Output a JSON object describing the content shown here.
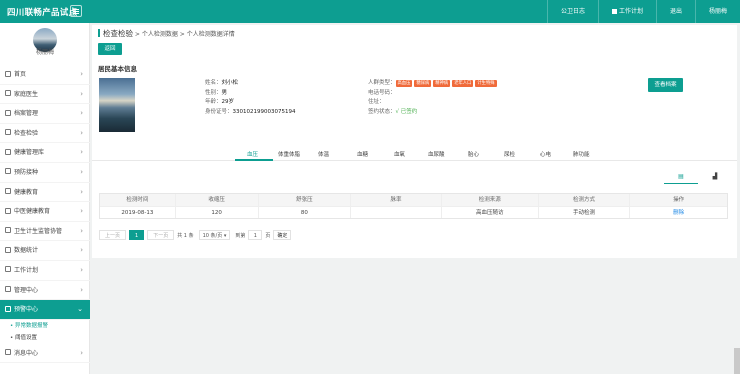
{
  "app": {
    "title": "四川联畅产品试点"
  },
  "topbar": {
    "links": [
      {
        "label": "公卫日志"
      },
      {
        "label": "工作计划"
      },
      {
        "label": "退出"
      },
      {
        "label": "杨丽梅"
      }
    ]
  },
  "user": {
    "name": "杨丽梅"
  },
  "sidebar": {
    "items": [
      {
        "label": "首页"
      },
      {
        "label": "家庭医生"
      },
      {
        "label": "档案管理"
      },
      {
        "label": "检查检验"
      },
      {
        "label": "健康管理库"
      },
      {
        "label": "预防接种"
      },
      {
        "label": "健康教育"
      },
      {
        "label": "中医健康教育"
      },
      {
        "label": "卫生计生监管协管"
      },
      {
        "label": "数据统计"
      },
      {
        "label": "工作计划"
      },
      {
        "label": "管理中心"
      },
      {
        "label": "预警中心"
      },
      {
        "label": "消息中心"
      }
    ],
    "submenu": [
      {
        "label": "异常数据报警"
      },
      {
        "label": "阈值设置"
      }
    ]
  },
  "breadcrumb": {
    "root": "检查检验",
    "level2": "个人检测数据",
    "level3": "个人检测数据详情"
  },
  "back_label": "返回",
  "section_title": "居民基本信息",
  "resident": {
    "name_label": "姓名：",
    "name": "刘小松",
    "gender_label": "性别：",
    "gender": "男",
    "age_label": "年龄：",
    "age": "29岁",
    "id_label": "身份证号：",
    "id": "330102199003075194",
    "type_label": "人群类型：",
    "tags": [
      "高血压",
      "糖尿病",
      "精神病",
      "老年人口",
      "计生特殊"
    ],
    "phone_label": "电话号码：",
    "phone": "",
    "address_label": "住址：",
    "address": "",
    "sign_label": "签约状态：",
    "sign_status": "√ 已签约"
  },
  "archive_button": "查看档案",
  "tabs": [
    "血压",
    "体重体脂",
    "体温",
    "血糖",
    "血氧",
    "血尿酸",
    "胎心",
    "尿检",
    "心电",
    "肺功能"
  ],
  "view_toggle": {
    "list": "▤",
    "chart": "▟"
  },
  "table": {
    "headers": [
      "检测时间",
      "收缩压",
      "舒张压",
      "脉率",
      "检测来源",
      "检测方式",
      "操作"
    ],
    "rows": [
      [
        "2019-08-13",
        "120",
        "80",
        "",
        "高血压随访",
        "手动检测",
        "删除"
      ]
    ]
  },
  "pager": {
    "prev": "上一页",
    "current": "1",
    "next": "下一页",
    "total_text": "共 1 条",
    "per_page": "10 条/页",
    "goto_label": "到第",
    "goto_value": "1",
    "page_unit": "页",
    "confirm": "确定"
  }
}
